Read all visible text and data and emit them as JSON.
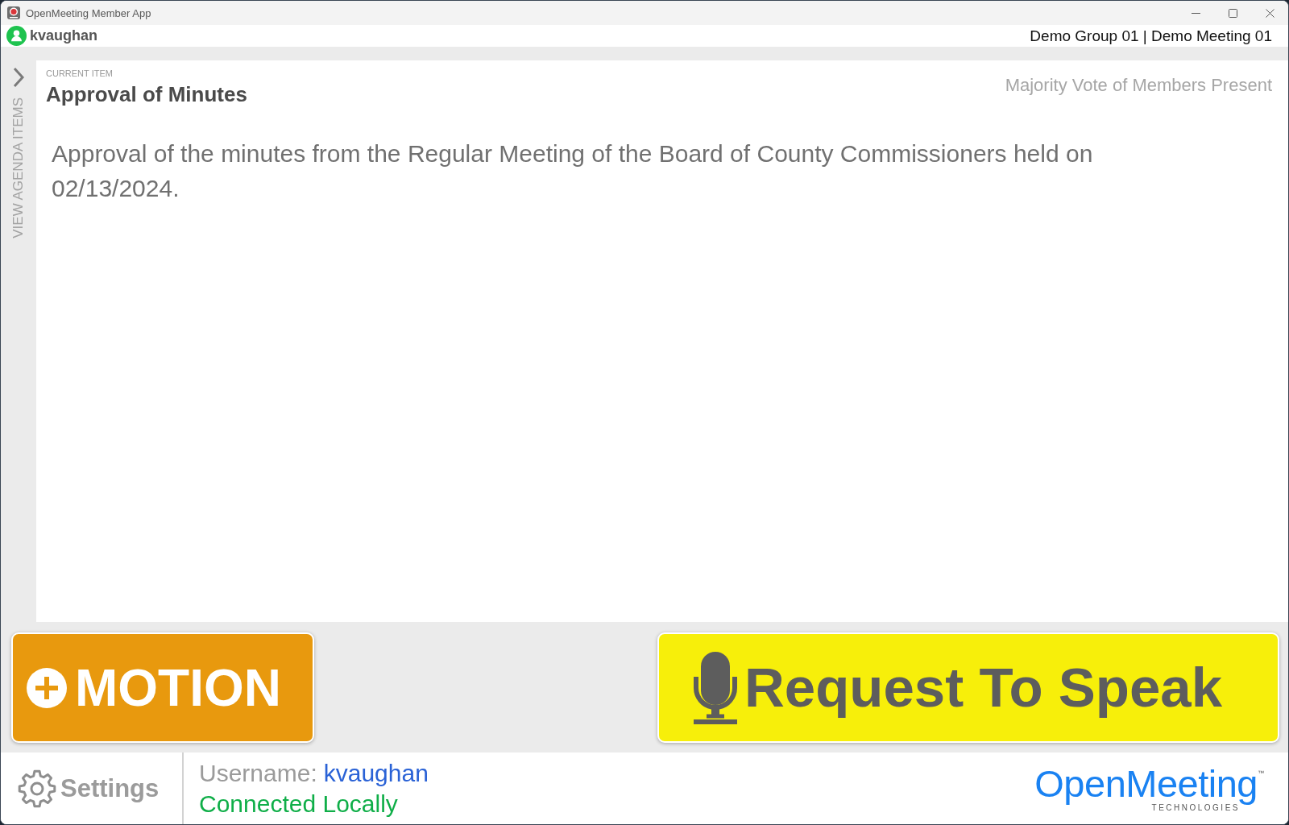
{
  "window": {
    "title": "OpenMeeting Member App"
  },
  "header": {
    "user": "kvaughan",
    "meeting": "Demo Group 01 | Demo Meeting 01"
  },
  "sidebar": {
    "label": "VIEW AGENDA ITEMS"
  },
  "current_item": {
    "caption": "CURRENT ITEM",
    "title": "Approval of Minutes",
    "vote_type": "Majority Vote of Members Present",
    "description": "Approval of the minutes from the Regular Meeting of the Board of County Commissioners held on 02/13/2024."
  },
  "actions": [
    {
      "kind": "motion",
      "label": "MOTION"
    },
    {
      "kind": "speak",
      "label": "Request To Speak"
    }
  ],
  "footer": {
    "settings": "Settings",
    "username_label": "Username:",
    "username": "kvaughan",
    "connection": "Connected Locally",
    "logo": {
      "name": "OpenMeeting",
      "tagline": "TECHNOLOGIES",
      "trademark": "™"
    }
  }
}
